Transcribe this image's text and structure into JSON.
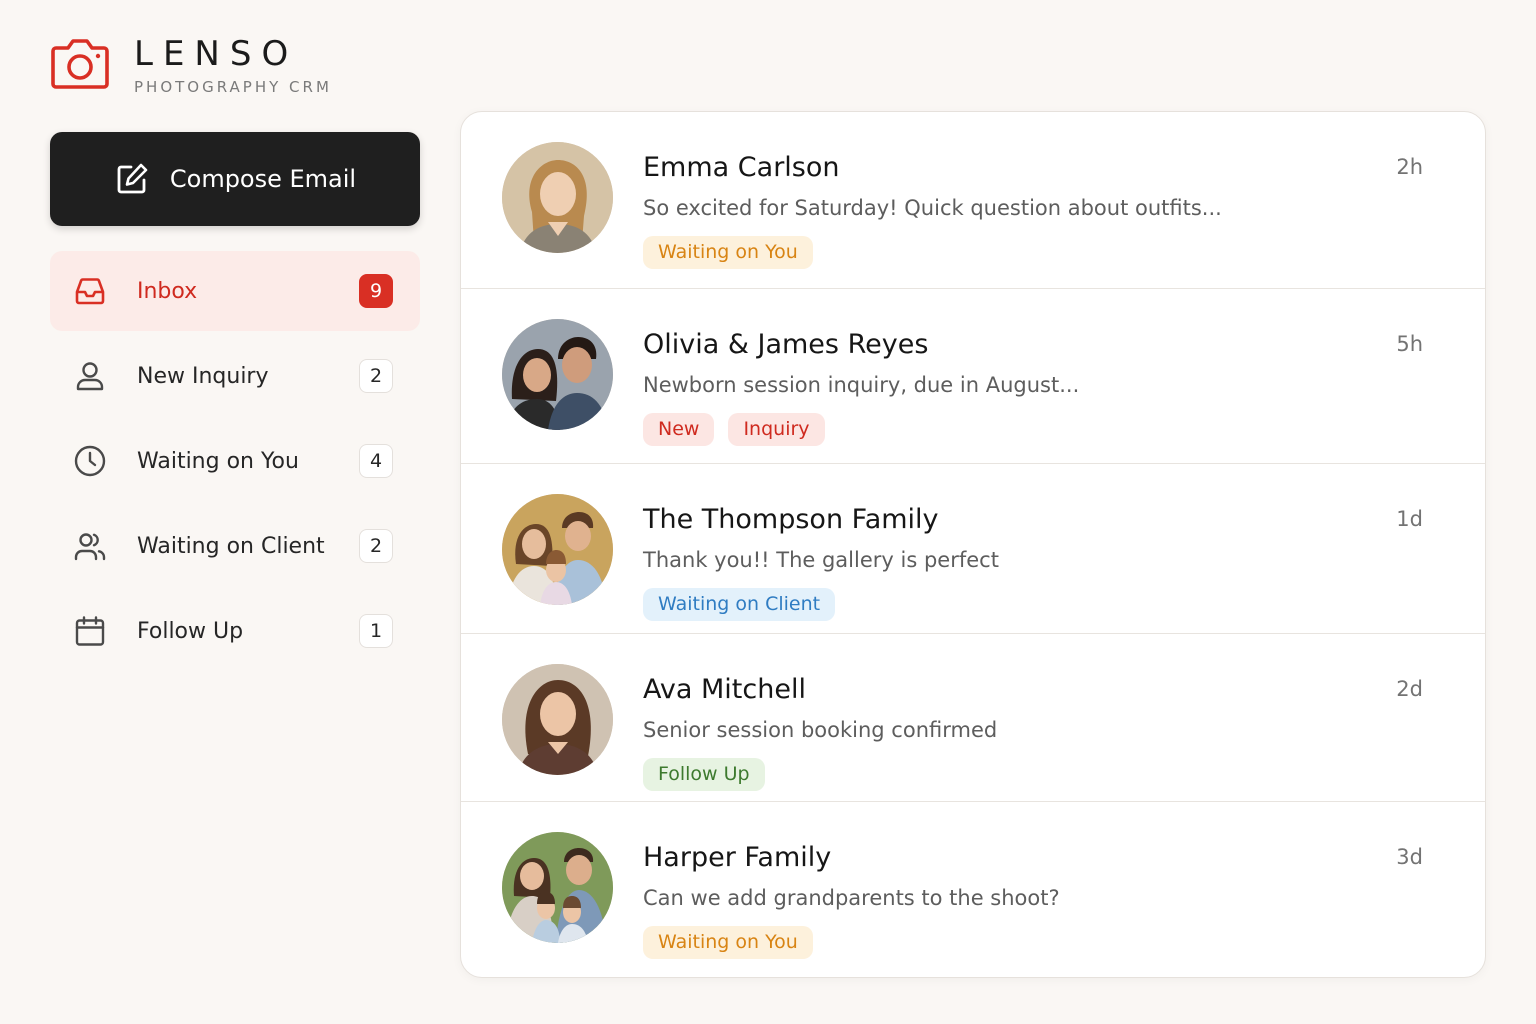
{
  "brand": {
    "name": "LENSO",
    "subtitle": "PHOTOGRAPHY CRM",
    "accent": "#d92f24"
  },
  "compose": {
    "label": "Compose Email",
    "icon": "edit-square-icon"
  },
  "sidebar": {
    "items": [
      {
        "label": "Inbox",
        "count": "9",
        "icon": "inbox-tray-icon",
        "active": true
      },
      {
        "label": "New Inquiry",
        "count": "2",
        "icon": "user-icon"
      },
      {
        "label": "Waiting on You",
        "count": "4",
        "icon": "clock-icon"
      },
      {
        "label": "Waiting on Client",
        "count": "2",
        "icon": "users-icon"
      },
      {
        "label": "Follow Up",
        "count": "1",
        "icon": "calendar-icon"
      }
    ]
  },
  "messages": [
    {
      "name": "Emma Carlson",
      "time": "2h",
      "snippet": "So excited for Saturday! Quick question about outfits...",
      "tags": [
        "Waiting on You"
      ]
    },
    {
      "name": "Olivia & James Reyes",
      "time": "5h",
      "snippet": "Newborn session inquiry, due in August...",
      "tags": [
        "New",
        "Inquiry"
      ]
    },
    {
      "name": "The Thompson Family",
      "time": "1d",
      "snippet": "Thank you!! The gallery is perfect",
      "tags": [
        "Waiting on Client"
      ]
    },
    {
      "name": "Ava Mitchell",
      "time": "2d",
      "snippet": "Senior session booking confirmed",
      "tags": [
        "Follow Up"
      ]
    },
    {
      "name": "Harper Family",
      "time": "3d",
      "snippet": "Can we add grandparents to the shoot?",
      "tags": [
        "Waiting on You"
      ]
    }
  ],
  "colors": {
    "tag_waiting_you": "#d88414",
    "tag_new": "#cf2a1f",
    "tag_waiting_client": "#2f7cc2",
    "tag_follow_up": "#3d7a2e"
  }
}
